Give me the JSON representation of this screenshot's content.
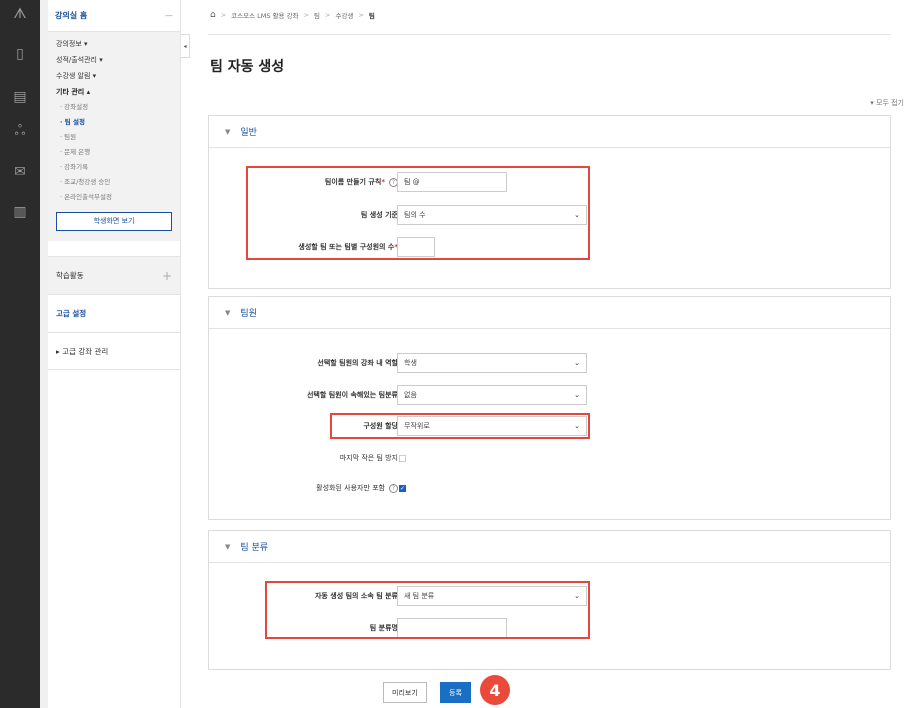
{
  "sidebar": {
    "home": "강의실 홈",
    "menu": [
      {
        "label": "강의정보 ▾"
      },
      {
        "label": "성적/출석관리 ▾"
      },
      {
        "label": "수강생 알림 ▾"
      },
      {
        "label": "기타 관리 ▴"
      }
    ],
    "sub": [
      "· 강좌설정",
      "· 팀 설정",
      "· 팀원",
      "· 문제 은행",
      "· 강좌기록",
      "· 조교/청강생 승인",
      "· 온라인출석부설정"
    ],
    "student_view_button": "학생화면 보기",
    "learning_activity": "학습활동",
    "advanced_settings": "고급 설정",
    "advanced_course": "▸  고급 강좌 관리"
  },
  "breadcrumb": [
    "코스모스 LMS 활용 강좌",
    "팀",
    "수강생",
    "팀"
  ],
  "page_title": "팀 자동 생성",
  "collapse_all": "▾ 모두 접기",
  "general": {
    "heading": "일반",
    "naming_label": "팀이름 만들기 규칙",
    "naming_value": "팀 @",
    "criteria_label": "팀 생성 기준",
    "criteria_value": "팀의 수",
    "count_label": "생성할 팀 또는 팀별 구성원의 수",
    "count_value": ""
  },
  "members": {
    "heading": "팀원",
    "role_label": "선택할 팀원의 강좌 내 역할",
    "role_value": "학생",
    "grouping_label": "선택할 팀원이 속해있는 팀분류",
    "grouping_value": "없음",
    "allocation_label": "구성원 할당",
    "allocation_value": "무작위로",
    "prevent_small_label": "마지막 작은 팀 방지",
    "active_only_label": "활성화된 사용자만 포함"
  },
  "grouping": {
    "heading": "팀 분류",
    "auto_label": "자동 생성 팀의 소속 팀 분류",
    "auto_value": "새 팀 분류",
    "name_label": "팀 분류명",
    "name_value": ""
  },
  "buttons": {
    "preview": "미리보기",
    "submit": "등록"
  },
  "badge": "4"
}
